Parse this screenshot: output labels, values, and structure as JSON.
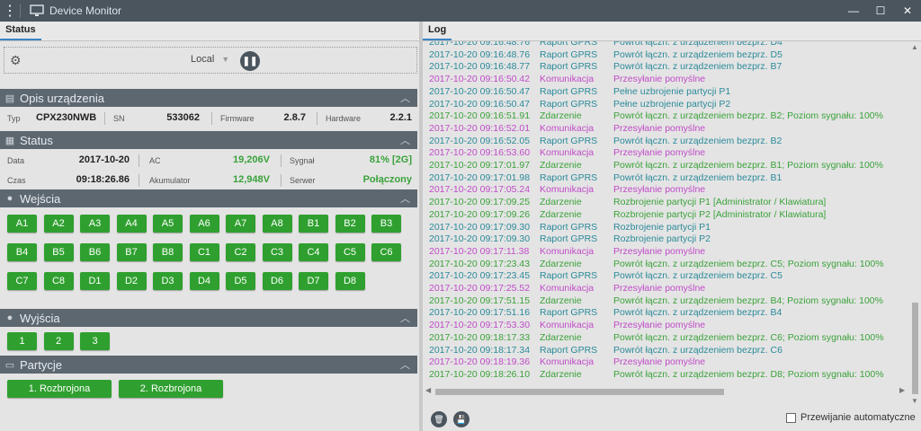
{
  "window": {
    "title": "Device Monitor",
    "minimize_icon": "minimize-icon",
    "maximize_icon": "maximize-icon",
    "close_icon": "close-icon"
  },
  "left": {
    "tab": "Status",
    "toolbar": {
      "connection": "Local"
    },
    "device": {
      "title": "Opis urządzenia",
      "type_label": "Typ",
      "type_value": "CPX230NWB",
      "sn_label": "SN",
      "sn_value": "533062",
      "fw_label": "Firmware",
      "fw_value": "2.8.7",
      "hw_label": "Hardware",
      "hw_value": "2.2.1"
    },
    "status": {
      "title": "Status",
      "date_label": "Data",
      "date_value": "2017-10-20",
      "ac_label": "AC",
      "ac_value": "19,206V",
      "signal_label": "Sygnał",
      "signal_value": "81% [2G]",
      "time_label": "Czas",
      "time_value": "09:18:26.86",
      "battery_label": "Akumulator",
      "battery_value": "12,948V",
      "server_label": "Serwer",
      "server_value": "Połączony"
    },
    "inputs": {
      "title": "Wejścia",
      "items": [
        "A1",
        "A2",
        "A3",
        "A4",
        "A5",
        "A6",
        "A7",
        "A8",
        "B1",
        "B2",
        "B3",
        "B4",
        "B5",
        "B6",
        "B7",
        "B8",
        "C1",
        "C2",
        "C3",
        "C4",
        "C5",
        "C6",
        "C7",
        "C8",
        "D1",
        "D2",
        "D3",
        "D4",
        "D5",
        "D6",
        "D7",
        "D8"
      ]
    },
    "outputs": {
      "title": "Wyjścia",
      "items": [
        "1",
        "2",
        "3"
      ]
    },
    "partitions": {
      "title": "Partycje",
      "items": [
        "1. Rozbrojona",
        "2. Rozbrojona"
      ]
    }
  },
  "right": {
    "tab": "Log",
    "auto_scroll_label": "Przewijanie automatyczne",
    "entries": [
      {
        "time": "2017-10-20 09:16:48.76",
        "source": "Raport GPRS",
        "message": "Powrót łączn. z urządzeniem bezprz. D4",
        "kind": "raport"
      },
      {
        "time": "2017-10-20 09:16:48.76",
        "source": "Raport GPRS",
        "message": "Powrót łączn. z urządzeniem bezprz. D5",
        "kind": "raport"
      },
      {
        "time": "2017-10-20 09:16:48.77",
        "source": "Raport GPRS",
        "message": "Powrót łączn. z urządzeniem bezprz. B7",
        "kind": "raport"
      },
      {
        "time": "2017-10-20 09:16:50.42",
        "source": "Komunikacja",
        "message": "Przesyłanie pomyślne",
        "kind": "kom"
      },
      {
        "time": "2017-10-20 09:16:50.47",
        "source": "Raport GPRS",
        "message": "Pełne uzbrojenie partycji P1",
        "kind": "raport"
      },
      {
        "time": "2017-10-20 09:16:50.47",
        "source": "Raport GPRS",
        "message": "Pełne uzbrojenie partycji P2",
        "kind": "raport"
      },
      {
        "time": "2017-10-20 09:16:51.91",
        "source": "Zdarzenie",
        "message": "Powrót łączn. z urządzeniem bezprz. B2; Poziom sygnału: 100%",
        "kind": "zd"
      },
      {
        "time": "2017-10-20 09:16:52.01",
        "source": "Komunikacja",
        "message": "Przesyłanie pomyślne",
        "kind": "kom"
      },
      {
        "time": "2017-10-20 09:16:52.05",
        "source": "Raport GPRS",
        "message": "Powrót łączn. z urządzeniem bezprz. B2",
        "kind": "raport"
      },
      {
        "time": "2017-10-20 09:16:53.60",
        "source": "Komunikacja",
        "message": "Przesyłanie pomyślne",
        "kind": "kom"
      },
      {
        "time": "2017-10-20 09:17:01.97",
        "source": "Zdarzenie",
        "message": "Powrót łączn. z urządzeniem bezprz. B1; Poziom sygnału: 100%",
        "kind": "zd"
      },
      {
        "time": "2017-10-20 09:17:01.98",
        "source": "Raport GPRS",
        "message": "Powrót łączn. z urządzeniem bezprz. B1",
        "kind": "raport"
      },
      {
        "time": "2017-10-20 09:17:05.24",
        "source": "Komunikacja",
        "message": "Przesyłanie pomyślne",
        "kind": "kom"
      },
      {
        "time": "2017-10-20 09:17:09.25",
        "source": "Zdarzenie",
        "message": "Rozbrojenie partycji P1 [Administrator / Klawiatura]",
        "kind": "zd"
      },
      {
        "time": "2017-10-20 09:17:09.26",
        "source": "Zdarzenie",
        "message": "Rozbrojenie partycji P2 [Administrator / Klawiatura]",
        "kind": "zd"
      },
      {
        "time": "2017-10-20 09:17:09.30",
        "source": "Raport GPRS",
        "message": "Rozbrojenie partycji P1",
        "kind": "raport"
      },
      {
        "time": "2017-10-20 09:17:09.30",
        "source": "Raport GPRS",
        "message": "Rozbrojenie partycji P2",
        "kind": "raport"
      },
      {
        "time": "2017-10-20 09:17:11.38",
        "source": "Komunikacja",
        "message": "Przesyłanie pomyślne",
        "kind": "kom"
      },
      {
        "time": "2017-10-20 09:17:23.43",
        "source": "Zdarzenie",
        "message": "Powrót łączn. z urządzeniem bezprz. C5; Poziom sygnału: 100%",
        "kind": "zd"
      },
      {
        "time": "2017-10-20 09:17:23.45",
        "source": "Raport GPRS",
        "message": "Powrót łączn. z urządzeniem bezprz. C5",
        "kind": "raport"
      },
      {
        "time": "2017-10-20 09:17:25.52",
        "source": "Komunikacja",
        "message": "Przesyłanie pomyślne",
        "kind": "kom"
      },
      {
        "time": "2017-10-20 09:17:51.15",
        "source": "Zdarzenie",
        "message": "Powrót łączn. z urządzeniem bezprz. B4; Poziom sygnału: 100%",
        "kind": "zd"
      },
      {
        "time": "2017-10-20 09:17:51.16",
        "source": "Raport GPRS",
        "message": "Powrót łączn. z urządzeniem bezprz. B4",
        "kind": "raport"
      },
      {
        "time": "2017-10-20 09:17:53.30",
        "source": "Komunikacja",
        "message": "Przesyłanie pomyślne",
        "kind": "kom"
      },
      {
        "time": "2017-10-20 09:18:17.33",
        "source": "Zdarzenie",
        "message": "Powrót łączn. z urządzeniem bezprz. C6; Poziom sygnału: 100%",
        "kind": "zd"
      },
      {
        "time": "2017-10-20 09:18:17.34",
        "source": "Raport GPRS",
        "message": "Powrót łączn. z urządzeniem bezprz. C6",
        "kind": "raport"
      },
      {
        "time": "2017-10-20 09:18:19.36",
        "source": "Komunikacja",
        "message": "Przesyłanie pomyślne",
        "kind": "kom"
      },
      {
        "time": "2017-10-20 09:18:26.10",
        "source": "Zdarzenie",
        "message": "Powrót łączn. z urządzeniem bezprz. D8; Poziom sygnału: 100%",
        "kind": "zd"
      }
    ]
  },
  "colors": {
    "raport": "#2a8a9a",
    "kom": "#c04bc8",
    "zd": "#3aa23a",
    "button_green": "#2fa02f",
    "header": "#5c6770"
  },
  "icons": {
    "menu": "menu-dots-icon",
    "monitor": "monitor-icon",
    "settings": "gear-icon",
    "pause": "pause-icon",
    "delete": "trash-icon",
    "save": "save-icon"
  }
}
